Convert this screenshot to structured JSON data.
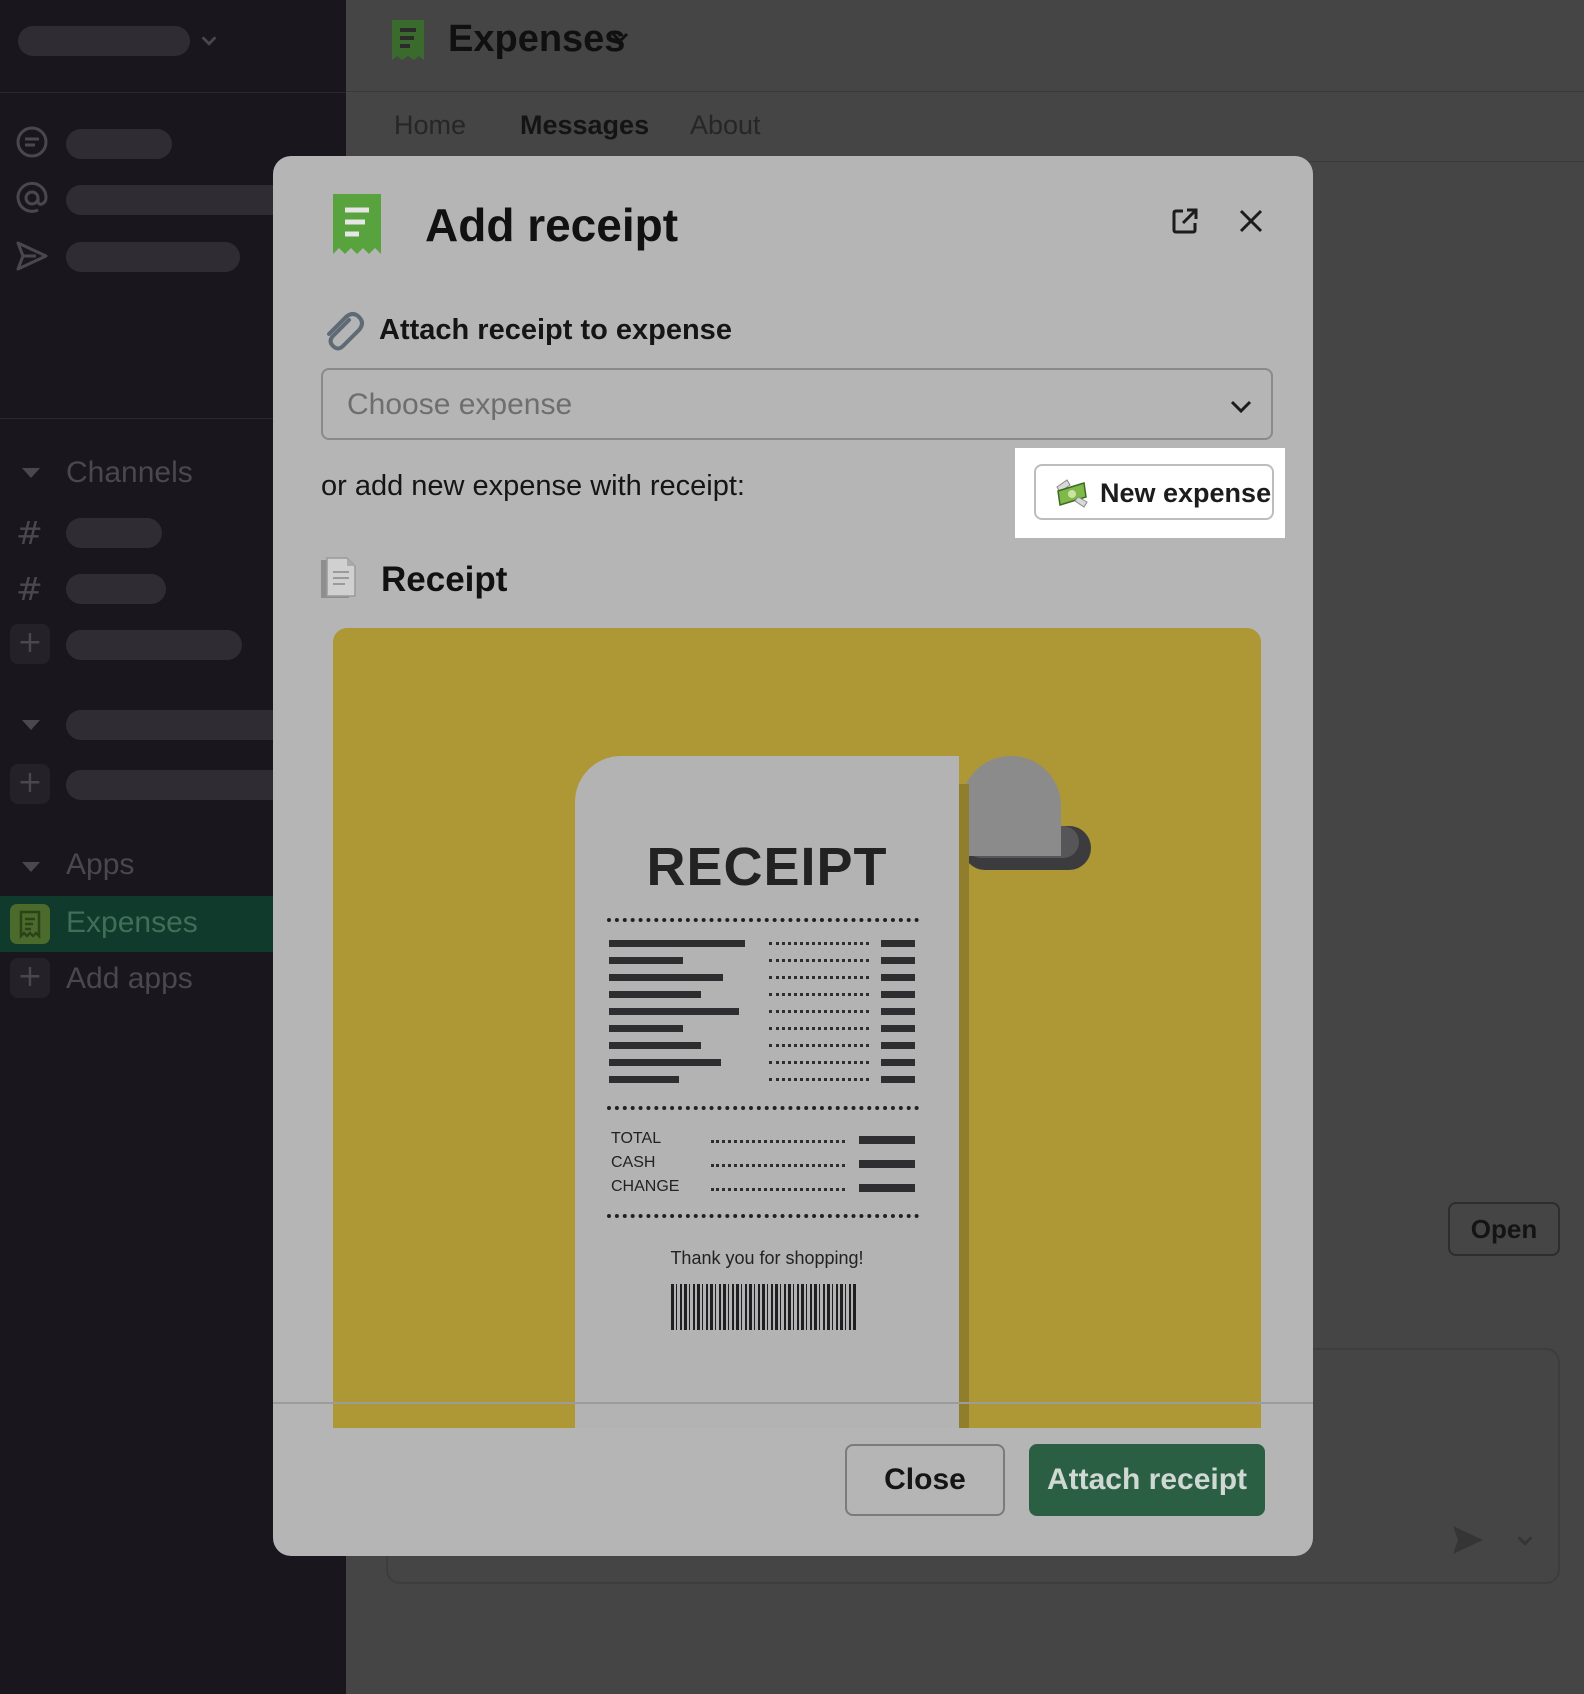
{
  "sidebar": {
    "sections": {
      "channels": "Channels",
      "apps": "Apps"
    },
    "apps": {
      "expenses": "Expenses",
      "add_apps": "Add apps"
    }
  },
  "main": {
    "title": "Expenses",
    "tabs": [
      "Home",
      "Messages",
      "About"
    ],
    "active_tab": "Messages",
    "open_button": "Open"
  },
  "modal": {
    "title": "Add receipt",
    "attach_label": "Attach receipt to expense",
    "select_placeholder": "Choose expense",
    "or_add_label": "or add new expense with receipt:",
    "new_expense_button": "New expense",
    "receipt_heading": "Receipt",
    "close_button": "Close",
    "attach_button": "Attach receipt"
  },
  "receipt_illustration": {
    "heading": "RECEIPT",
    "currency": "$",
    "summary_rows": [
      "TOTAL",
      "CASH",
      "CHANGE"
    ],
    "thanks": "Thank you for shopping!"
  },
  "icons": {
    "app": "receipt-app-icon",
    "popout": "external-link-icon",
    "close": "close-icon",
    "paperclip": "paperclip-icon",
    "money": "money-with-wings-icon",
    "document": "document-icon",
    "chevron": "chevron-down-icon"
  },
  "colors": {
    "accent_green": "#2a5f44",
    "app_icon_green": "#58a33d",
    "receipt_background": "#ae9735",
    "sidebar_selected": "#103a2c"
  }
}
